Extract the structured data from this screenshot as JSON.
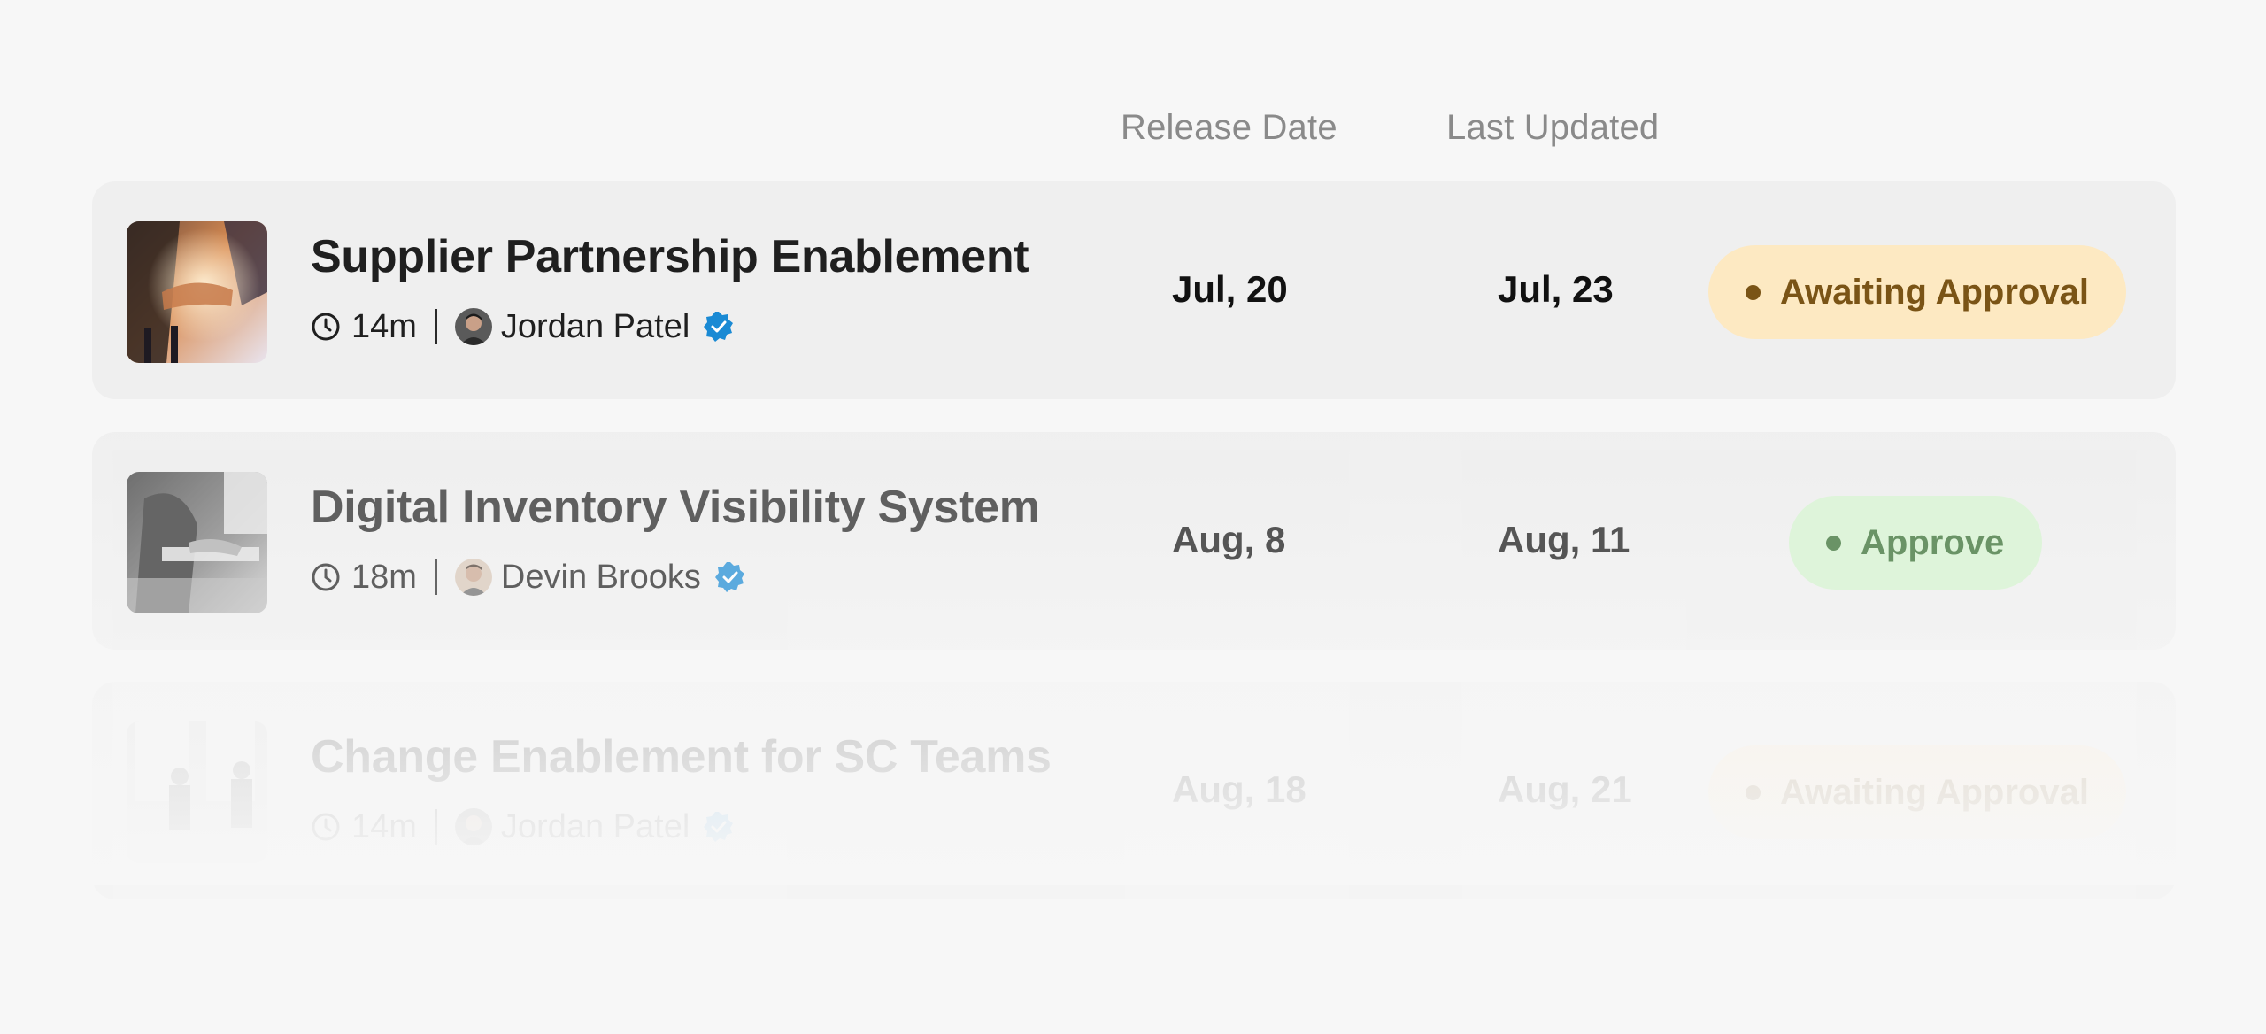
{
  "table": {
    "columns": {
      "release_date": "Release Date",
      "last_updated": "Last Updated"
    },
    "rows": [
      {
        "title": "Supplier Partnership Enablement",
        "duration": "14m",
        "author": "Jordan Patel",
        "release_date": "Jul, 20",
        "last_updated": "Jul, 23",
        "status": "Awaiting Approval",
        "thumbnail_icon": "handshake-photo"
      },
      {
        "title": "Digital Inventory Visibility System",
        "duration": "18m",
        "author": "Devin Brooks",
        "release_date": "Aug, 8",
        "last_updated": "Aug, 11",
        "status": "Approve",
        "thumbnail_icon": "meeting-photo"
      },
      {
        "title": "Change Enablement for SC Teams",
        "duration": "14m",
        "author": "Jordan Patel",
        "release_date": "Aug, 18",
        "last_updated": "Aug, 21",
        "status": "Awaiting Approval",
        "thumbnail_icon": "office-team-photo"
      }
    ]
  },
  "colors": {
    "awaiting_bg": "#fde9c2",
    "awaiting_text": "#7a5416",
    "approve_bg": "#d4f4ce",
    "approve_text": "#2f6a2a",
    "verified_blue": "#1a8ad4"
  }
}
